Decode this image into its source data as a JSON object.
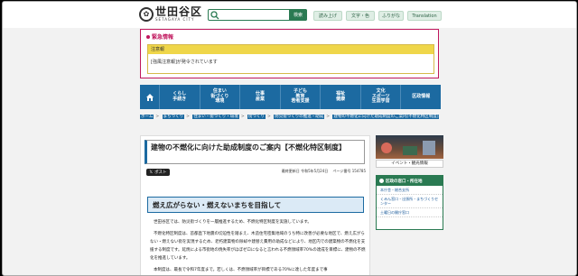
{
  "header": {
    "logo_name": "世田谷区",
    "logo_sub": "SETAGAYA CITY",
    "search_placeholder": "",
    "search_button": "検索",
    "tools": [
      "読み上げ",
      "文字・色",
      "ふりがな",
      "Translation"
    ]
  },
  "emergency": {
    "title": "緊急情報",
    "box_head": "注意報",
    "box_text": "[強風注意報]が発令されています"
  },
  "global_nav": {
    "items": [
      "くらし\n手続き",
      "住まい\n街づくり\n環境",
      "仕事\n産業",
      "子ども\n教育\n若者支援",
      "福祉\n健康",
      "文化\nスポーツ\n生涯学習",
      "区政情報"
    ]
  },
  "breadcrumb": {
    "items": [
      "ホーム",
      "まちづくり",
      "住まい・街づくり・環境",
      "街づくり",
      "防災街づくりの推進・助成",
      "建物の不燃化に向けた助成制度のご案内[不燃化特区制度]"
    ]
  },
  "article": {
    "title": "建物の不燃化に向けた助成制度のご案内【不燃化特区制度】",
    "x_button": "ポスト",
    "updated": "最終更新日 令和5年5月24日",
    "page_no": "ページ番号 154785",
    "heading": "燃え広がらない・燃えないまちを目指して",
    "paragraphs": [
      "世田谷区では、防災街づくりを一層推進するため、不燃化特区制度を実施しています。",
      "不燃化特区制度は、首都直下地震の切迫性を踏まえ、木造住宅密集地域のうち特に改善が必要な地区で、燃え広がらない・燃えない街を実現するため、老朽建築物の除却や建替え費用の助成などにより、地区内での建築物の不燃化を支援する制度です。延焼による市街地の焼失率がほぼゼロになると言われる不燃領域率70%の達成を目標に、建物の不燃化を推進しています。",
      "本制度は、最長で令和7年度まで。若しくは、不燃領域率が目標である70%に達した年度まで事"
    ]
  },
  "sidebar": {
    "banner_label": "イベント・観光情報",
    "panel_title": "区政の窓口・所在地",
    "panel_items": [
      "本庁舎・総合支所",
      "くみん窓口・出張所・まちづくりセンター",
      "土曜日の開庁窓口"
    ]
  }
}
